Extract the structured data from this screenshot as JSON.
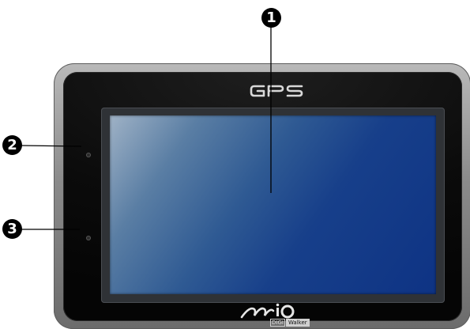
{
  "logos": {
    "top": "GPS",
    "brand": "Mio",
    "brand_sub_1": "DIGI",
    "brand_sub_2": "Walker"
  },
  "callouts": [
    "1",
    "2",
    "3"
  ],
  "colors": {
    "screen": "#173f8a",
    "bezel": "#0b0b0b",
    "frame": "#8a8a8a"
  }
}
